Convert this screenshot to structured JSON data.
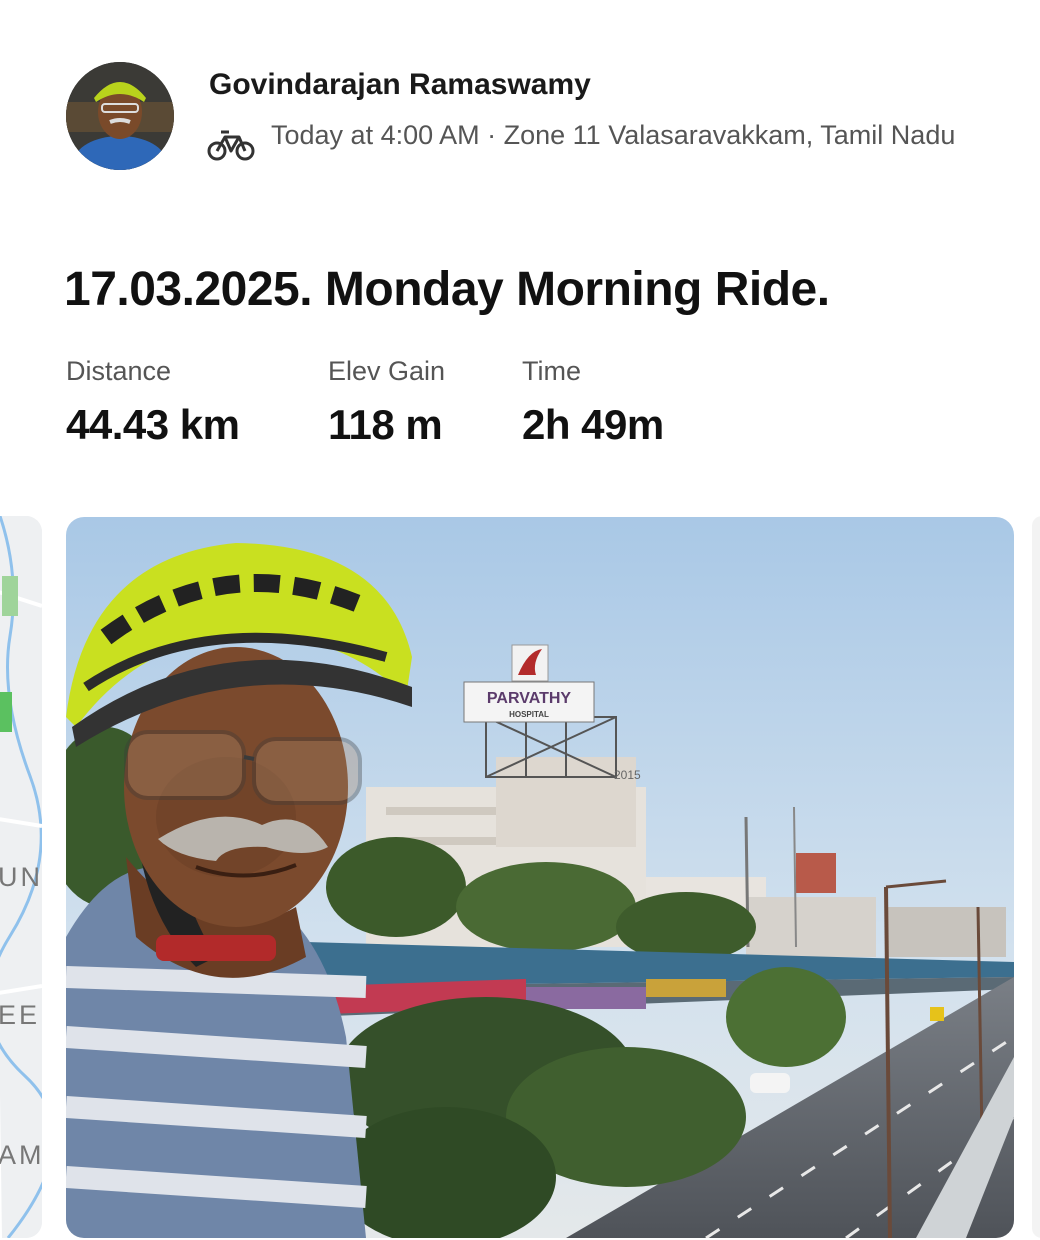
{
  "activity": {
    "athlete_name": "Govindarajan Ramaswamy",
    "sport_icon": "bicycle-icon",
    "meta_line": "Today at 4:00 AM · Zone 11 Valasaravakkam, Tamil Nadu",
    "title": "17.03.2025. Monday Morning Ride."
  },
  "stats": [
    {
      "label": "Distance",
      "value": "44.43 km"
    },
    {
      "label": "Elev Gain",
      "value": "118 m"
    },
    {
      "label": "Time",
      "value": "2h 49m"
    }
  ],
  "map_peek": {
    "labels": [
      "UN",
      "EE",
      "AM"
    ]
  },
  "photo": {
    "sign_text": "PARVATHY",
    "sign_subtext": "HOSPITAL",
    "building_text": "2015"
  },
  "colors": {
    "text_primary": "#111111",
    "text_secondary": "#555555",
    "helmet": "#c9e020",
    "sky": "#b9d2ea"
  }
}
